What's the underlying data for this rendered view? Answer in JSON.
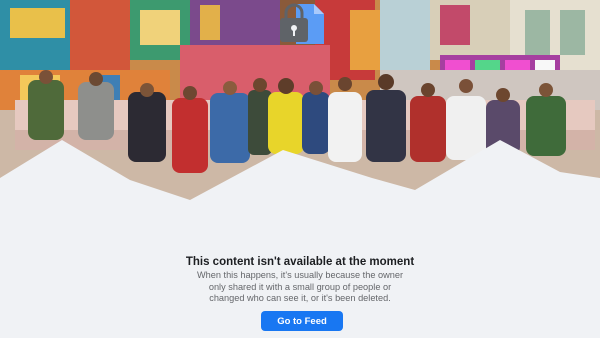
{
  "notice": {
    "title": "This content isn't available at the moment",
    "description": "When this happens, it's usually because the owner only shared it with a small group of people or changed who can see it, or it's been deleted.",
    "button_label": "Go to Feed"
  },
  "colors": {
    "page_background": "#f0f2f5",
    "button_background": "#1877f2",
    "title_text": "#1c1e21",
    "description_text": "#65676b",
    "lock_body": "#5f6368",
    "document": "#5b9cf5"
  },
  "icons": {
    "unavailable": "lock-document-icon"
  }
}
